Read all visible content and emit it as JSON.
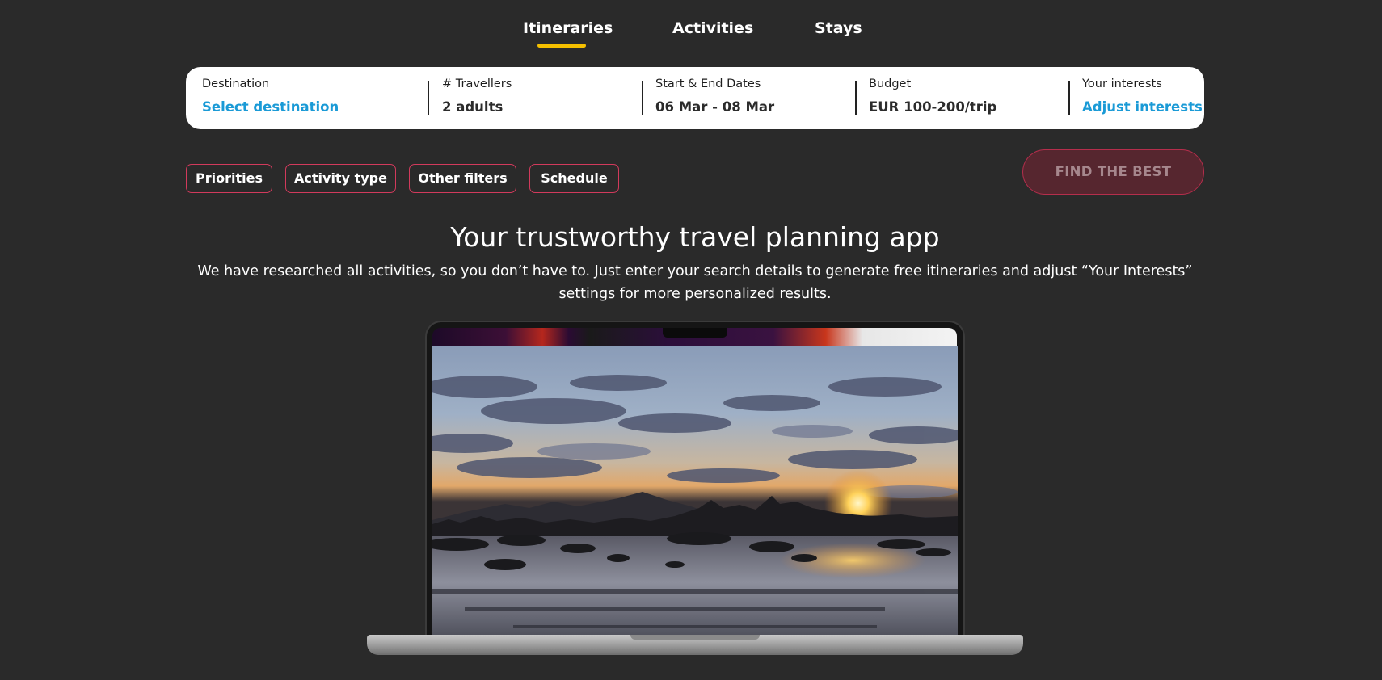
{
  "tabs": [
    {
      "label": "Itineraries",
      "active": true
    },
    {
      "label": "Activities",
      "active": false
    },
    {
      "label": "Stays",
      "active": false
    }
  ],
  "search": {
    "destination": {
      "label": "Destination",
      "value": "Select destination"
    },
    "travellers": {
      "label": "# Travellers",
      "value": "2 adults"
    },
    "dates": {
      "label": "Start & End Dates",
      "value": "06 Mar - 08 Mar"
    },
    "budget": {
      "label": "Budget",
      "value": "EUR 100-200/trip"
    },
    "interests": {
      "label": "Your interests",
      "value": "Adjust interests"
    }
  },
  "filters": {
    "priorities": "Priorities",
    "activity_type": "Activity type",
    "other_filters": "Other filters",
    "schedule": "Schedule"
  },
  "cta": {
    "label": "FIND THE BEST"
  },
  "hero": {
    "title": "Your trustworthy travel planning app",
    "subtitle": "We have researched all activities, so you don’t have to. Just enter your search details to generate free itineraries and adjust “Your Interests” settings for more personalized results."
  },
  "colors": {
    "background": "#2a2a2a",
    "tab_underline": "#f5c000",
    "accent_link": "#1a9ad6",
    "chip_border": "#d23a5c",
    "cta_background": "#56262f"
  }
}
